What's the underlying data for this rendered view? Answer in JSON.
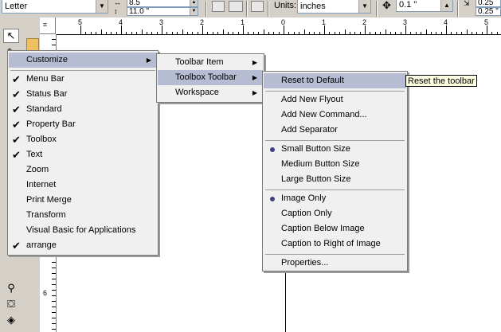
{
  "property_bar": {
    "paper_size": "Letter",
    "width_value": "8.5",
    "height_value": "11.0 \"",
    "units_label": "Units:",
    "units_value": "inches",
    "nudge_value": "0.1 \"",
    "dup_x": "0.25",
    "dup_y": "0.25 \""
  },
  "rulers": {
    "horizontal_labels": [
      "5",
      "4",
      "3",
      "2",
      "1",
      "0",
      "1",
      "2",
      "3",
      "4",
      "5"
    ],
    "vertical_labels": [
      "6"
    ]
  },
  "menus": {
    "main": {
      "items": [
        {
          "label": "Customize",
          "checked": false,
          "submenu": true,
          "highlighted": true
        },
        {
          "label": "Menu Bar",
          "checked": true
        },
        {
          "label": "Status Bar",
          "checked": true
        },
        {
          "label": "Standard",
          "checked": true
        },
        {
          "label": "Property Bar",
          "checked": true
        },
        {
          "label": "Toolbox",
          "checked": true
        },
        {
          "label": "Text",
          "checked": true
        },
        {
          "label": "Zoom",
          "checked": false
        },
        {
          "label": "Internet",
          "checked": false
        },
        {
          "label": "Print Merge",
          "checked": false
        },
        {
          "label": "Transform",
          "checked": false
        },
        {
          "label": "Visual Basic for Applications",
          "checked": false
        },
        {
          "label": "arrange",
          "checked": true
        }
      ]
    },
    "customize": {
      "items": [
        {
          "label": "Toolbar Item",
          "submenu": true
        },
        {
          "label": "Toolbox Toolbar",
          "submenu": true,
          "highlighted": true
        },
        {
          "label": "Workspace",
          "submenu": true
        }
      ]
    },
    "toolbox_toolbar": {
      "items": [
        {
          "label": "Reset to Default",
          "highlighted": true
        },
        {
          "label": "Add New Flyout"
        },
        {
          "label": "Add New Command..."
        },
        {
          "label": "Add Separator"
        },
        {
          "label": "Small Button Size",
          "selected": true
        },
        {
          "label": "Medium Button Size"
        },
        {
          "label": "Large Button Size"
        },
        {
          "label": "Image Only",
          "selected": true
        },
        {
          "label": "Caption Only"
        },
        {
          "label": "Caption Below Image"
        },
        {
          "label": "Caption to Right of Image"
        },
        {
          "label": "Properties..."
        }
      ]
    }
  },
  "tooltip": "Reset the toolbar",
  "colors": {
    "menu_bg": "#f0f0f0",
    "menu_highlight": "#b6bdd2",
    "chrome": "#d4d0c8",
    "tooltip_bg": "#ffffe1"
  },
  "icons": {
    "check": "✔",
    "submenu_arrow": "▶",
    "dropdown_arrow": "▼"
  }
}
